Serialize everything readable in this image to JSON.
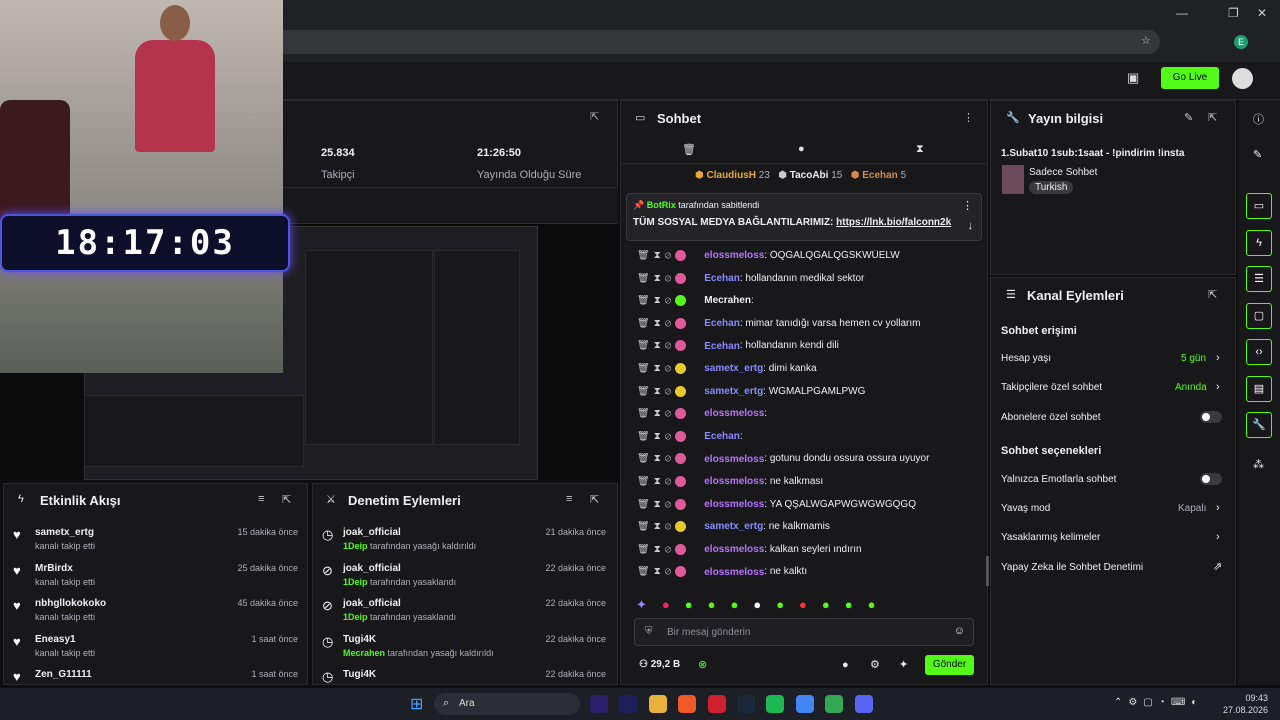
{
  "browser": {
    "search_placeholder": "Ara"
  },
  "header": {
    "go_live": "Go Live"
  },
  "stats": {
    "followers_value": "25.834",
    "followers_label": "Takipçi",
    "uptime_value": "21:26:50",
    "uptime_label": "Yayında Olduğu Süre"
  },
  "overlay": {
    "clock": "18:17:03"
  },
  "chat": {
    "title": "Sohbet",
    "top_chatters": [
      {
        "name": "ClaudiusH",
        "count": "23"
      },
      {
        "name": "TacoAbi",
        "count": "15"
      },
      {
        "name": "Ecehan",
        "count": "5"
      }
    ],
    "pinned": {
      "author": "BotRix",
      "by": "tarafından sabitlendi",
      "text": "TÜM SOSYAL MEDYA BAĞLANTILARIMIZ: ",
      "link": "https://lnk.bio/falconn2k"
    },
    "messages": [
      {
        "user": "elossmeloss",
        "text": ": ÖQĞALQĞALQĞSKWÜELW"
      },
      {
        "user": "Ecehan",
        "text": ": hollandanın medikal sektor"
      },
      {
        "user": "Mecrahen",
        "text": ":"
      },
      {
        "user": "Ecehan",
        "text": ": mimar tanıdığı varsa hemen cv yollarım"
      },
      {
        "user": "Ecehan",
        "text": ": hollandanın kendi dili"
      },
      {
        "user": "sametx_ertg",
        "text": ": dimi kanka"
      },
      {
        "user": "sametx_ertg",
        "text": ": WĞMALPĞAMLPWĞ"
      },
      {
        "user": "elossmeloss",
        "text": ":"
      },
      {
        "user": "Ecehan",
        "text": ":"
      },
      {
        "user": "elossmeloss",
        "text": ": gotunu dondu ossura ossura uyuyor"
      },
      {
        "user": "elossmeloss",
        "text": ": ne kalkması"
      },
      {
        "user": "elossmeloss",
        "text": ": YA QŞALWĞAPWĞWĞWĞQĞQ"
      },
      {
        "user": "sametx_ertg",
        "text": ": ne kalkmamis"
      },
      {
        "user": "elossmeloss",
        "text": ": kalkan seyleri ındırın"
      },
      {
        "user": "elossmeloss",
        "text": ": ne kalktı"
      }
    ],
    "input_placeholder": "Bir mesaj gönderin",
    "viewers": "29,2 B",
    "send": "Gönder"
  },
  "info": {
    "title": "Yayın bilgisi",
    "stream_title": "1.Subat10 1sub:1saat - !pindirim !insta",
    "category": "Sadece Sohbet",
    "tag": "Turkish"
  },
  "actions": {
    "title": "Kanal Eylemleri",
    "access_title": "Sohbet erişimi",
    "account_age": "Hesap yaşı",
    "account_age_value": "5 gün",
    "followers_only": "Takipçilere özel sohbet",
    "followers_only_value": "Anında",
    "subs_only": "Abonelere özel sohbet",
    "options_title": "Sohbet seçenekleri",
    "emotes_only": "Yalnızca Emotlarla sohbet",
    "slow_mode": "Yavaş mod",
    "slow_mode_value": "Kapalı",
    "banned_words": "Yasaklanmış kelimeler",
    "ai_mod": "Yapay Zeka ile Sohbet Denetimi"
  },
  "activity": {
    "title": "Etkinlik Akışı",
    "items": [
      {
        "name": "sametx_ertg",
        "sub": "kanalı takip etti",
        "time": "15 dakika önce"
      },
      {
        "name": "MrBirdx",
        "sub": "kanalı takip etti",
        "time": "25 dakika önce"
      },
      {
        "name": "nbhgllokokoko",
        "sub": "kanalı takip etti",
        "time": "45 dakika önce"
      },
      {
        "name": "Eneasy1",
        "sub": "kanalı takip etti",
        "time": "1 saat önce"
      },
      {
        "name": "Zen_G11111",
        "sub": "",
        "time": "1 saat önce"
      }
    ]
  },
  "moderation": {
    "title": "Denetim Eylemleri",
    "items": [
      {
        "name": "joak_official",
        "actor": "1Deip",
        "sub": " tarafından yasağı kaldırıldı",
        "time": "21 dakika önce"
      },
      {
        "name": "joak_official",
        "actor": "1Deip",
        "sub": " tarafından yasaklandı",
        "time": "22 dakika önce"
      },
      {
        "name": "joak_official",
        "actor": "1Deip",
        "sub": " tarafından yasaklandı",
        "time": "22 dakika önce"
      },
      {
        "name": "Tugi4K",
        "actor": "Mecrahen",
        "sub": " tarafından yasağı kaldırıldı",
        "time": "22 dakika önce"
      },
      {
        "name": "Tugi4K",
        "actor": "",
        "sub": "",
        "time": "22 dakika önce"
      }
    ]
  },
  "taskbar": {
    "time": "09:43",
    "date": "27.08.2026"
  }
}
